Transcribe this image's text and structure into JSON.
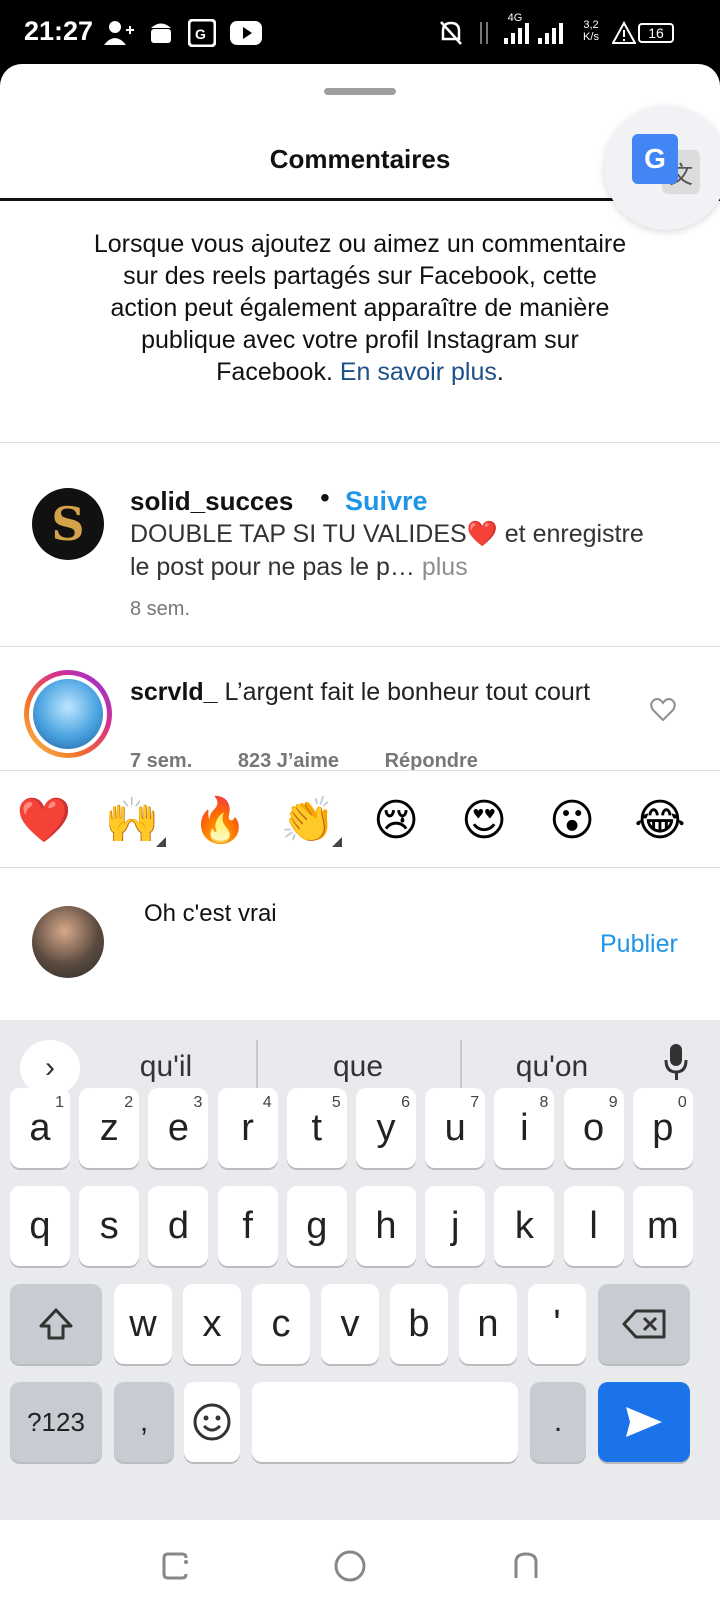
{
  "status_bar": {
    "time": "21:27",
    "network": "4G",
    "speed": "3,2\nK/s",
    "battery": "16"
  },
  "sheet": {
    "title": "Commentaires",
    "notice_text": "Lorsque vous ajoutez ou aimez un commentaire sur des reels partagés sur Facebook, cette action peut également apparaître de manière publique avec votre profil Instagram sur Facebook. ",
    "notice_link": "En savoir plus",
    "notice_end": "."
  },
  "translate": {
    "g": "G",
    "wen": "文"
  },
  "comments": [
    {
      "avatar_letter": "S",
      "user": "solid_succes",
      "dot": "•",
      "follow": "Suivre",
      "text": "DOUBLE TAP SI TU VALIDES❤️ et enregistre le post pour ne pas le p…",
      "more": " plus",
      "time": "8 sem."
    },
    {
      "user": "scrvld_",
      "text": " L’argent fait le bonheur tout court",
      "time": "7 sem.",
      "likes": "823 J’aime",
      "reply": "Répondre"
    }
  ],
  "emoji_bar": [
    "❤️",
    "🙌",
    "🔥",
    "👏",
    "😢",
    "😍",
    "😮",
    "😂"
  ],
  "composer": {
    "value": "Oh c'est vrai",
    "publish": "Publier"
  },
  "keyboard": {
    "suggestions": [
      "qu'il",
      "que",
      "qu'on"
    ],
    "row1": [
      "a",
      "z",
      "e",
      "r",
      "t",
      "y",
      "u",
      "i",
      "o",
      "p"
    ],
    "row1_nums": [
      "1",
      "2",
      "3",
      "4",
      "5",
      "6",
      "7",
      "8",
      "9",
      "0"
    ],
    "row2": [
      "q",
      "s",
      "d",
      "f",
      "g",
      "h",
      "j",
      "k",
      "l",
      "m"
    ],
    "row3": [
      "w",
      "x",
      "c",
      "v",
      "b",
      "n",
      "'"
    ],
    "symbols": "?123",
    "comma": ",",
    "period": "."
  }
}
